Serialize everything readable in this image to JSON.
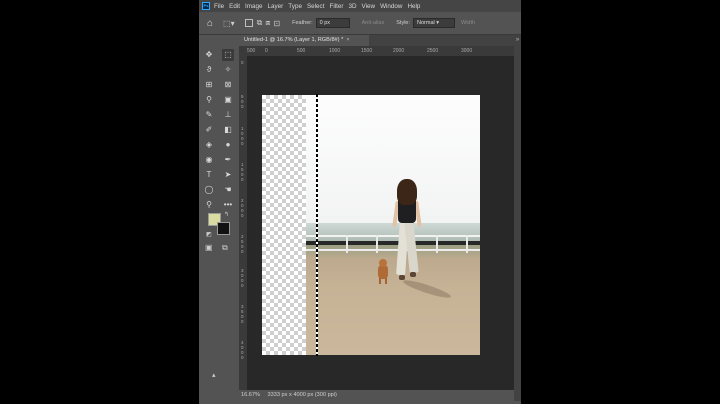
{
  "app": {
    "logo": "Ps",
    "menu": [
      "File",
      "Edit",
      "Image",
      "Layer",
      "Type",
      "Select",
      "Filter",
      "3D",
      "View",
      "Window",
      "Help"
    ]
  },
  "options": {
    "feather_label": "Feather:",
    "feather_value": "0 px",
    "antialias_label": "Anti-alias",
    "style_label": "Style:",
    "style_value": "Normal",
    "width_label": "Width"
  },
  "document": {
    "tab_title": "Untitled-1 @ 16.7% (Layer 1, RGB/8#) *",
    "tab_close": "×"
  },
  "ruler": {
    "top_ticks": [
      "500",
      "0",
      "500",
      "1000",
      "1500",
      "2000",
      "2500",
      "3000"
    ],
    "left_ticks": [
      "0",
      "500",
      "1000",
      "1500",
      "2000",
      "2500",
      "3000",
      "3500",
      "4000"
    ]
  },
  "status": {
    "zoom": "16.67%",
    "info": "3333 px x 4000 px (300 ppi)"
  },
  "colors": {
    "foreground": "#d9dba0",
    "background": "#111111",
    "ui_bg": "#535353",
    "canvas_bg": "#282828"
  }
}
